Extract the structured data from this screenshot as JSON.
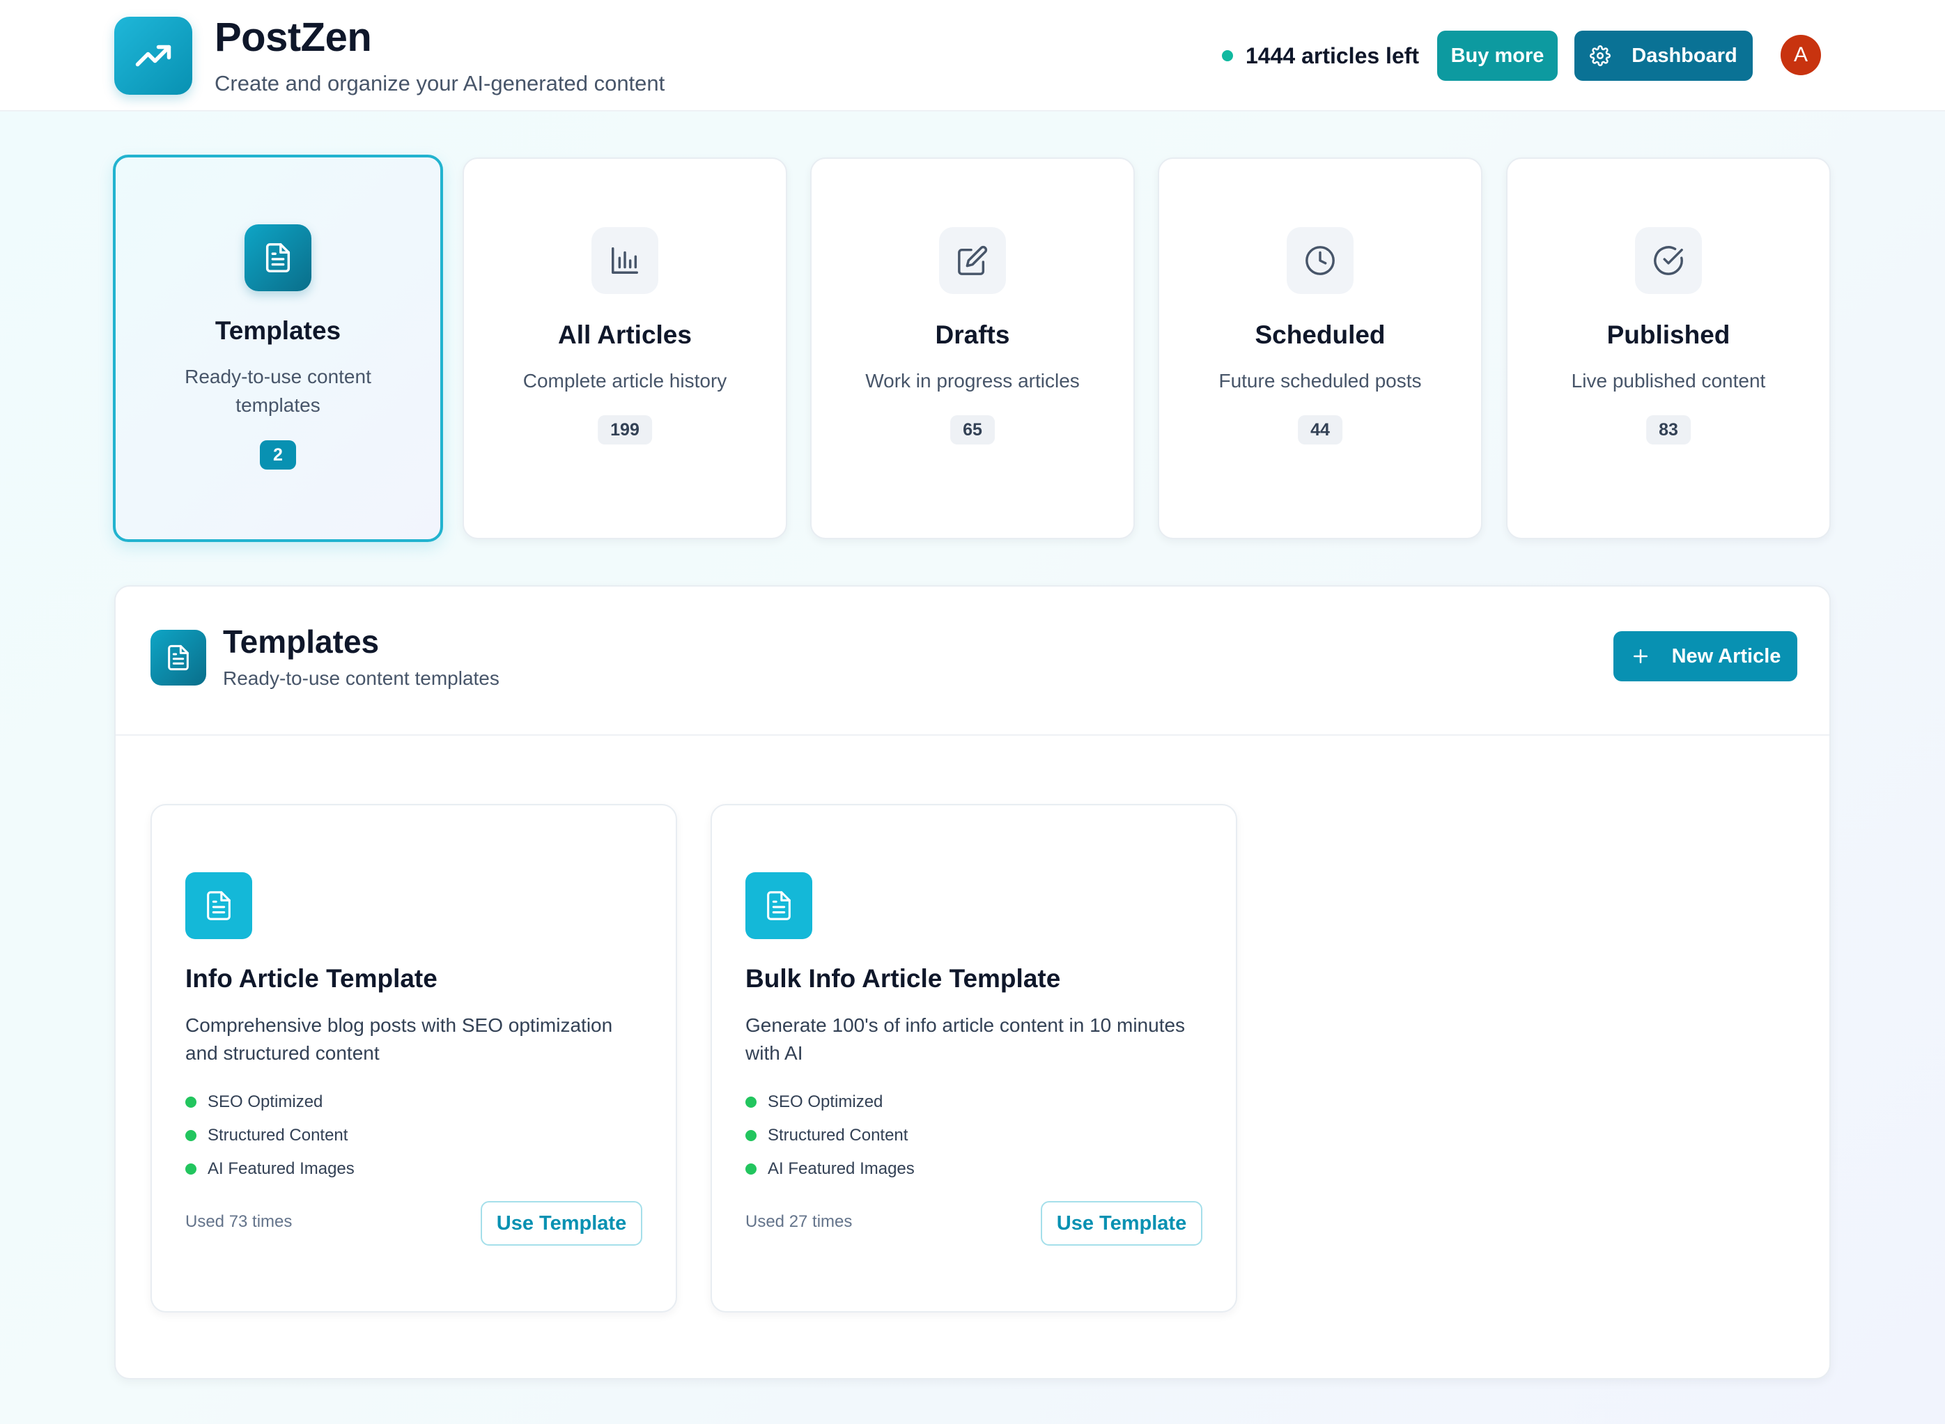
{
  "header": {
    "app_name": "PostZen",
    "tagline": "Create and organize your AI-generated content",
    "logo_icon": "trending-up-icon",
    "credits_text": "1444 articles left",
    "buy_more_label": "Buy more",
    "dashboard_label": "Dashboard",
    "avatar_initial": "A"
  },
  "categories": [
    {
      "title": "Templates",
      "description": "Ready-to-use content templates",
      "count": "2",
      "icon": "file-text-icon",
      "active": true
    },
    {
      "title": "All Articles",
      "description": "Complete article history",
      "count": "199",
      "icon": "bar-chart-icon",
      "active": false
    },
    {
      "title": "Drafts",
      "description": "Work in progress articles",
      "count": "65",
      "icon": "edit-icon",
      "active": false
    },
    {
      "title": "Scheduled",
      "description": "Future scheduled posts",
      "count": "44",
      "icon": "clock-icon",
      "active": false
    },
    {
      "title": "Published",
      "description": "Live published content",
      "count": "83",
      "icon": "check-circle-icon",
      "active": false
    }
  ],
  "panel": {
    "title": "Templates",
    "subtitle": "Ready-to-use content templates",
    "new_article_label": "New Article"
  },
  "templates": [
    {
      "title": "Info Article Template",
      "description": "Comprehensive blog posts with SEO optimization and structured content",
      "features": [
        "SEO Optimized",
        "Structured Content",
        "AI Featured Images"
      ],
      "usage": "Used 73 times",
      "button_label": "Use Template"
    },
    {
      "title": "Bulk Info Article Template",
      "description": "Generate 100's of info article content in 10 minutes with AI",
      "features": [
        "SEO Optimized",
        "Structured Content",
        "AI Featured Images"
      ],
      "usage": "Used 27 times",
      "button_label": "Use Template"
    }
  ],
  "colors": {
    "primary": "#0891b2",
    "teal_button": "#0d9aa0",
    "dashboard_button": "#0a7295",
    "avatar": "#c8330f",
    "status_dot": "#10b9a0",
    "feature_dot": "#22c55e"
  }
}
